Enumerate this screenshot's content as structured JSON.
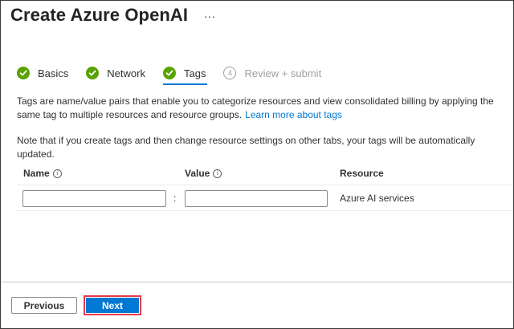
{
  "header": {
    "title": "Create Azure OpenAI",
    "more_label": "..."
  },
  "steps": [
    {
      "label": "Basics",
      "state": "completed"
    },
    {
      "label": "Network",
      "state": "completed"
    },
    {
      "label": "Tags",
      "state": "active"
    },
    {
      "label": "Review + submit",
      "state": "disabled",
      "number": "4"
    }
  ],
  "description": {
    "text": "Tags are name/value pairs that enable you to categorize resources and view consolidated billing by applying the same tag to multiple resources and resource groups.",
    "learn_more": "Learn more about tags",
    "note": "Note that if you create tags and then change resource settings on other tabs, your tags will be automatically updated."
  },
  "tags_table": {
    "columns": {
      "name": "Name",
      "value": "Value",
      "resource": "Resource"
    },
    "info_icon": "i",
    "rows": [
      {
        "name": "",
        "separator": ":",
        "value": "",
        "resource": "Azure AI services"
      }
    ]
  },
  "footer": {
    "previous_label": "Previous",
    "next_label": "Next"
  },
  "colors": {
    "accent": "#0078d4",
    "success": "#57a300",
    "highlight_border": "#e8394a"
  }
}
